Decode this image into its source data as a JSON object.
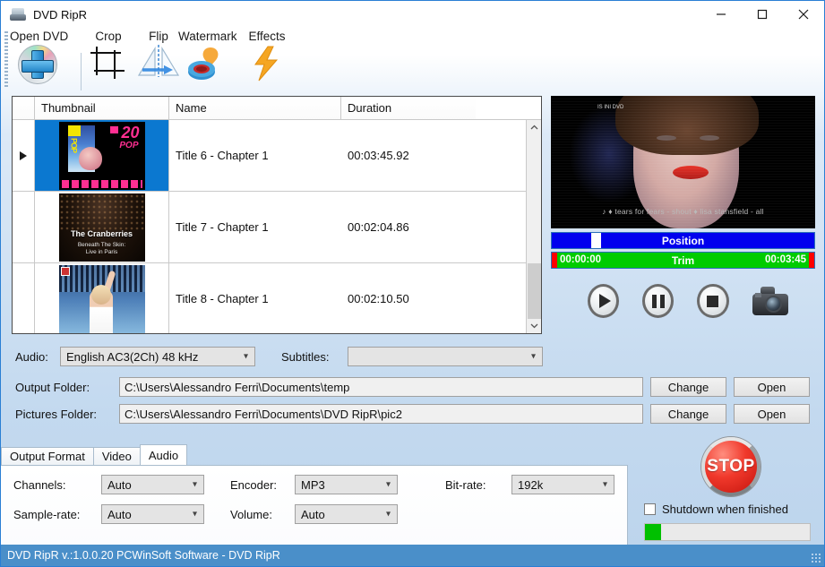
{
  "window": {
    "title": "DVD RipR",
    "icon": "dvd-drive-icon",
    "controls": {
      "minimize": "minimize-icon",
      "maximize": "maximize-icon",
      "close": "close-icon"
    }
  },
  "toolbar": {
    "items": [
      {
        "label": "Open DVD",
        "icon": "open-dvd-icon"
      },
      {
        "label": "Crop",
        "icon": "crop-icon"
      },
      {
        "label": "Flip",
        "icon": "flip-icon"
      },
      {
        "label": "Watermark",
        "icon": "watermark-icon"
      },
      {
        "label": "Effects",
        "icon": "effects-icon"
      }
    ]
  },
  "title_list": {
    "columns": [
      "",
      "Thumbnail",
      "Name",
      "Duration"
    ],
    "rows": [
      {
        "indicator": "▶",
        "name": "Title 6 - Chapter 1",
        "duration": "00:03:45.92",
        "selected": true,
        "thumb": {
          "kind": "mtv-pop-cover",
          "text_20": "20",
          "text_pop": "POP",
          "text_pop_vertical": "POP"
        }
      },
      {
        "indicator": "",
        "name": "Title 7 - Chapter 1",
        "duration": "00:02:04.86",
        "selected": false,
        "thumb": {
          "kind": "cranberries-cover",
          "line1": "The Cranberries",
          "line2": "Beneath The Skin:",
          "line3": "Live in Paris"
        }
      },
      {
        "indicator": "",
        "name": "Title 8 - Chapter 1",
        "duration": "00:02:10.50",
        "selected": false,
        "thumb": {
          "kind": "live-stage-singer"
        }
      }
    ],
    "scrollbar": {
      "up": "chevron-up-icon",
      "down": "chevron-down-icon"
    }
  },
  "preview": {
    "overlay_logo": "IS INI\nDVD",
    "ticker": "♪  ♦  tears for fears - shout  ♦  lisa stansfield - all",
    "position_bar": {
      "label": "Position",
      "handle_pct": 15
    },
    "trim_bar": {
      "start": "00:00:00",
      "label": "Trim",
      "end": "00:03:45"
    },
    "transport": [
      {
        "name": "play-button",
        "icon": "play-icon"
      },
      {
        "name": "pause-button",
        "icon": "pause-icon"
      },
      {
        "name": "stop-button",
        "icon": "stop-icon"
      },
      {
        "name": "snapshot-button",
        "icon": "camera-icon"
      }
    ]
  },
  "tracks": {
    "audio_label": "Audio:",
    "audio_value": "English AC3(2Ch) 48 kHz",
    "subtitles_label": "Subtitles:",
    "subtitles_value": ""
  },
  "folders": {
    "output_label": "Output Folder:",
    "output_path": "C:\\Users\\Alessandro Ferri\\Documents\\temp",
    "pictures_label": "Pictures Folder:",
    "pictures_path": "C:\\Users\\Alessandro Ferri\\Documents\\DVD RipR\\pic2",
    "change_label": "Change",
    "open_label": "Open"
  },
  "tabs": {
    "items": [
      "Output Format",
      "Video",
      "Audio"
    ],
    "active": "Audio"
  },
  "audio_settings": {
    "channels_label": "Channels:",
    "channels_value": "Auto",
    "samplerate_label": "Sample-rate:",
    "samplerate_value": "Auto",
    "encoder_label": "Encoder:",
    "encoder_value": "MP3",
    "volume_label": "Volume:",
    "volume_value": "Auto",
    "bitrate_label": "Bit-rate:",
    "bitrate_value": "192k"
  },
  "actions": {
    "stop_label": "STOP",
    "shutdown_label": "Shutdown when finished",
    "shutdown_checked": false,
    "progress_pct": 10
  },
  "status": {
    "text": "DVD RipR v.:1.0.0.20 PCWinSoft Software - DVD RipR"
  },
  "colors": {
    "accent_blue": "#2a7fd4",
    "status_bar": "#4a8fc9",
    "selection": "#0b78d0",
    "position_bar": "#0000ee",
    "trim_bar": "#00cc00",
    "trim_marker": "#ff0000",
    "progress_green": "#00c000",
    "stop_red": "#f0382b"
  }
}
